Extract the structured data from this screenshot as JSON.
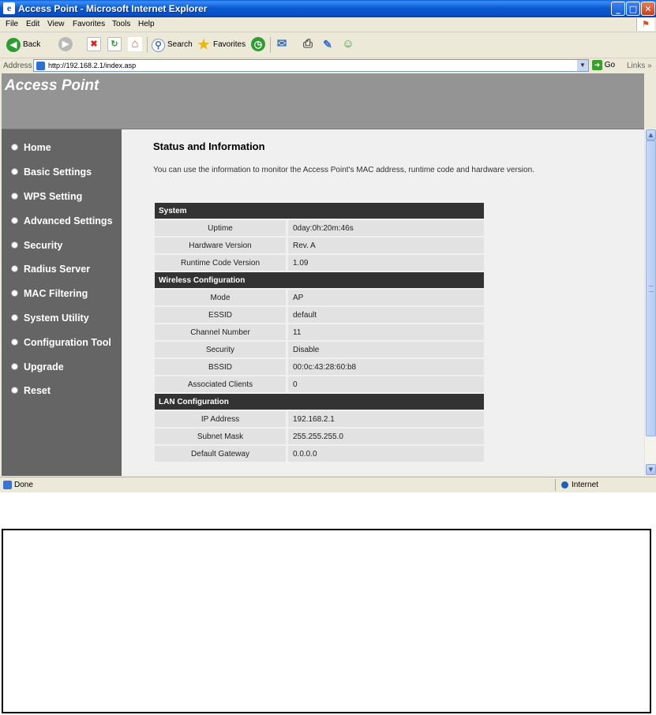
{
  "window": {
    "title": "Access Point - Microsoft Internet Explorer",
    "app_icon": "e",
    "controls": {
      "minimize": "_",
      "maximize": "□",
      "close": "✕"
    }
  },
  "menubar": {
    "items": [
      "File",
      "Edit",
      "View",
      "Favorites",
      "Tools",
      "Help"
    ],
    "logo": "⚑"
  },
  "toolbar": {
    "back": "Back",
    "back_glyph": "◀",
    "forward_glyph": "▶",
    "stop_glyph": "✖",
    "refresh_glyph": "↻",
    "home_glyph": "⌂",
    "search": "Search",
    "search_glyph": "⚲",
    "favorites": "Favorites",
    "favorites_glyph": "★",
    "history_glyph": "◷",
    "mail_glyph": "✉",
    "print_glyph": "⎙",
    "edit_glyph": "✎",
    "messenger_glyph": "☺"
  },
  "address": {
    "label": "Address",
    "url": "http://192.168.2.1/index.asp",
    "dropdown_glyph": "▼",
    "go": "Go",
    "go_glyph": "➜",
    "links": "Links",
    "links_glyph": "»"
  },
  "banner": {
    "title": "Access Point"
  },
  "nav": {
    "items": [
      "Home",
      "Basic Settings",
      "WPS Setting",
      "Advanced Settings",
      "Security",
      "Radius Server",
      "MAC Filtering",
      "System Utility",
      "Configuration Tool",
      "Upgrade",
      "Reset"
    ]
  },
  "content": {
    "title": "Status and Information",
    "description": "You can use the information to monitor the Access Point's MAC address, runtime code and hardware version.",
    "sections": {
      "system": {
        "title": "System",
        "rows": [
          {
            "label": "Uptime",
            "value": "0day:0h:20m:46s"
          },
          {
            "label": "Hardware Version",
            "value": "Rev. A"
          },
          {
            "label": "Runtime Code Version",
            "value": "1.09"
          }
        ]
      },
      "wireless": {
        "title": "Wireless Configuration",
        "rows": [
          {
            "label": "Mode",
            "value": "AP"
          },
          {
            "label": "ESSID",
            "value": "default"
          },
          {
            "label": "Channel Number",
            "value": "11"
          },
          {
            "label": "Security",
            "value": "Disable"
          },
          {
            "label": "BSSID",
            "value": "00:0c:43:28:60:b8"
          },
          {
            "label": "Associated Clients",
            "value": "0"
          }
        ]
      },
      "lan": {
        "title": "LAN Configuration",
        "rows": [
          {
            "label": "IP Address",
            "value": "192.168.2.1"
          },
          {
            "label": "Subnet Mask",
            "value": "255.255.255.0"
          },
          {
            "label": "Default Gateway",
            "value": "0.0.0.0"
          }
        ]
      }
    }
  },
  "scrollbar": {
    "up_glyph": "▲",
    "down_glyph": "▼"
  },
  "status": {
    "text": "Done",
    "zone": "Internet"
  }
}
